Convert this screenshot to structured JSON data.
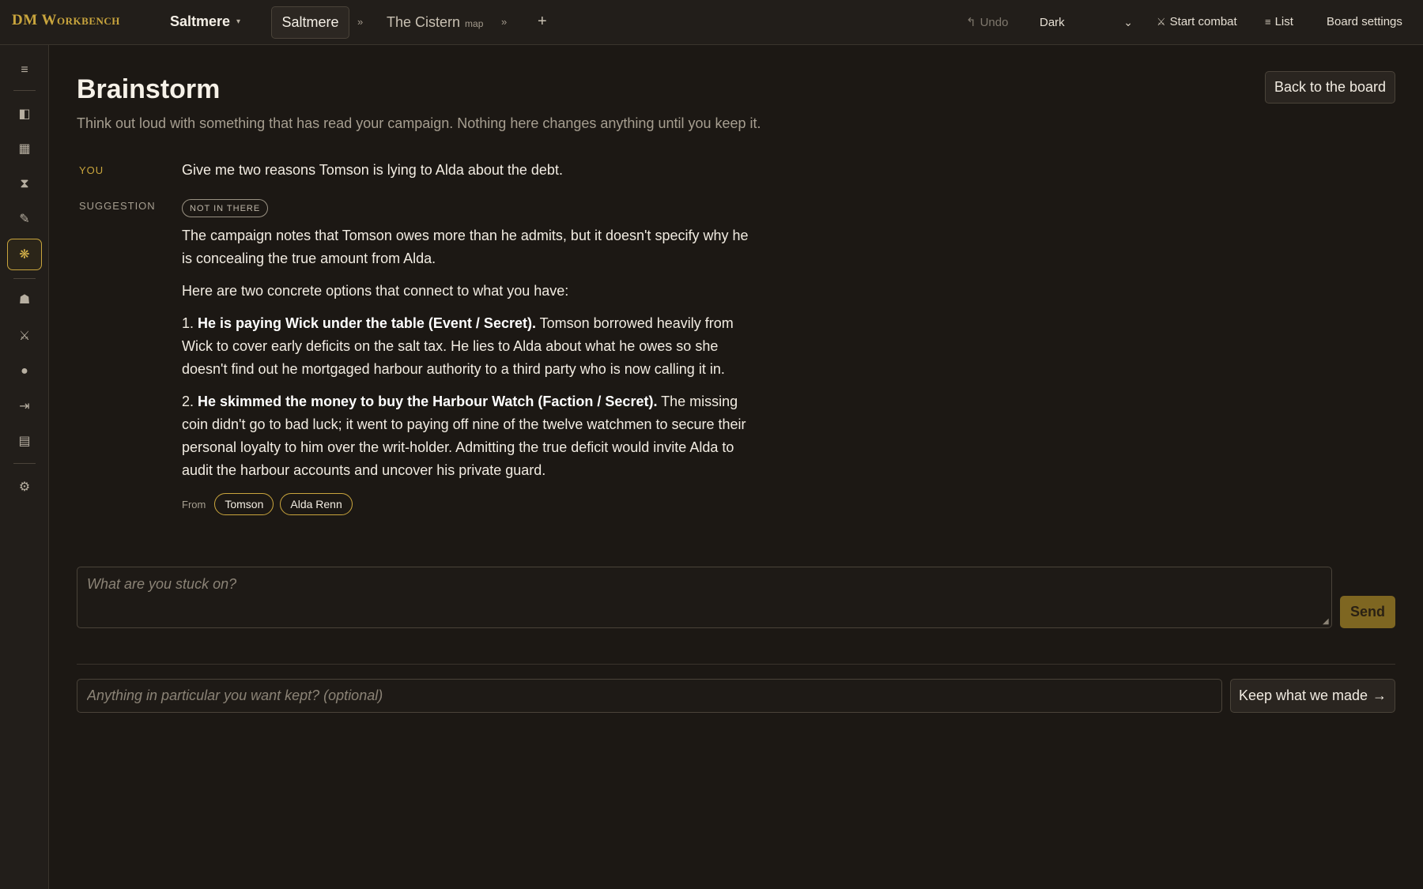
{
  "app": {
    "brand": "DM Workbench"
  },
  "header": {
    "campaign": "Saltmere",
    "tabs": [
      {
        "label": "Saltmere",
        "sub": ""
      },
      {
        "label": "The Cistern",
        "sub": "map"
      }
    ],
    "chevron": "»",
    "add": "+",
    "undo_icon": "↰",
    "undo": "Undo",
    "theme": "Dark",
    "start_combat_icon": "⚔",
    "start_combat": "Start combat",
    "list_icon": "≡",
    "list": "List",
    "board_settings": "Board settings"
  },
  "sidebar": {
    "icons": [
      "menu-icon",
      "panel-icon",
      "board-icon",
      "hourglass-icon",
      "quill-icon",
      "sparkle-icon",
      "bell-icon",
      "swords-icon",
      "dot-icon",
      "export-icon",
      "notes-icon",
      "gear-icon"
    ],
    "glyphs": [
      "≡",
      "◧",
      "▦",
      "⧗",
      "✎",
      "❋",
      "☗",
      "⚔",
      "●",
      "⇥",
      "▤",
      "⚙"
    ]
  },
  "main": {
    "title": "Brainstorm",
    "subtitle": "Think out loud with something that has read your campaign. Nothing here changes anything until you keep it.",
    "back_button": "Back to the board",
    "you_label": "YOU",
    "you_message": "Give me two reasons Tomson is lying to Alda about the debt.",
    "suggestion_label": "SUGGESTION",
    "badge": "NOT IN THERE",
    "para1": "The campaign notes that Tomson owes more than he admits, but it doesn't specify why he is concealing the true amount from Alda.",
    "para2": "Here are two concrete options that connect to what you have:",
    "option1_num": "1. ",
    "option1_title": "He is paying Wick under the table (Event / Secret).",
    "option1_text": " Tomson borrowed heavily from Wick to cover early deficits on the salt tax. He lies to Alda about what he owes so she doesn't find out he mortgaged harbour authority to a third party who is now calling it in.",
    "option2_num": "2. ",
    "option2_title": "He skimmed the money to buy the Harbour Watch (Faction / Secret).",
    "option2_text": " The missing coin didn't go to bad luck; it went to paying off nine of the twelve watchmen to secure their personal loyalty to him over the writ-holder. Admitting the true deficit would invite Alda to audit the harbour accounts and uncover his private guard.",
    "from_label": "From",
    "sources": [
      "Tomson",
      "Alda Renn"
    ],
    "prompt_placeholder": "What are you stuck on?",
    "send": "Send",
    "keep_placeholder": "Anything in particular you want kept? (optional)",
    "keep_button": "Keep what we made",
    "keep_arrow": "→"
  },
  "colors": {
    "accent": "#c9a53d",
    "background": "#1c1814",
    "panel": "#221e1a"
  }
}
